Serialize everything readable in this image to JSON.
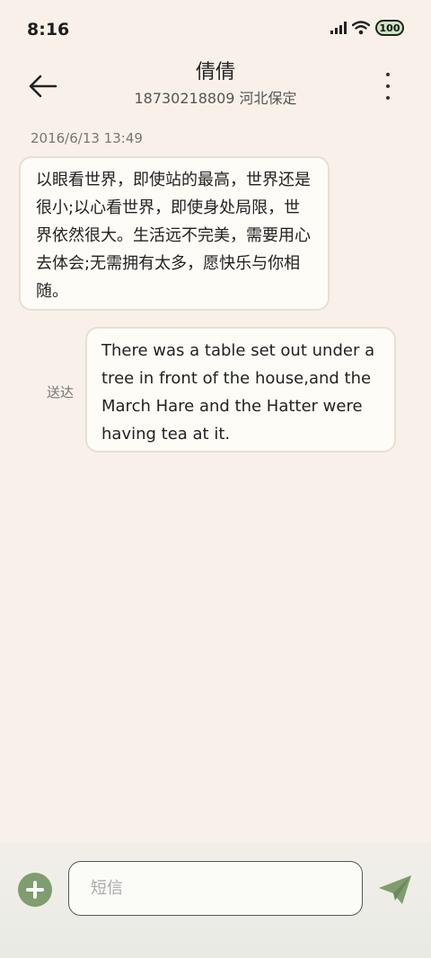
{
  "status_bar": {
    "time": "8:16",
    "battery": "100"
  },
  "header": {
    "name": "倩倩",
    "subtitle": "18730218809 河北保定"
  },
  "conversation": {
    "timestamp": "2016/6/13 13:49",
    "incoming_message": "以眼看世界，即使站的最高，世界还是很小;以心看世界，即使身处局限，世界依然很大。生活远不完美，需要用心去体会;无需拥有太多，愿快乐与你相随。",
    "outgoing_message": "There was a table set out under a tree in front of the house,and the March Hare and the Hatter were having tea at it.",
    "delivery_status": "送达"
  },
  "composer": {
    "placeholder": "短信"
  },
  "colors": {
    "background": "#f9f1e9",
    "accent": "#7f9d6e",
    "bubble": "#fefcf7"
  }
}
